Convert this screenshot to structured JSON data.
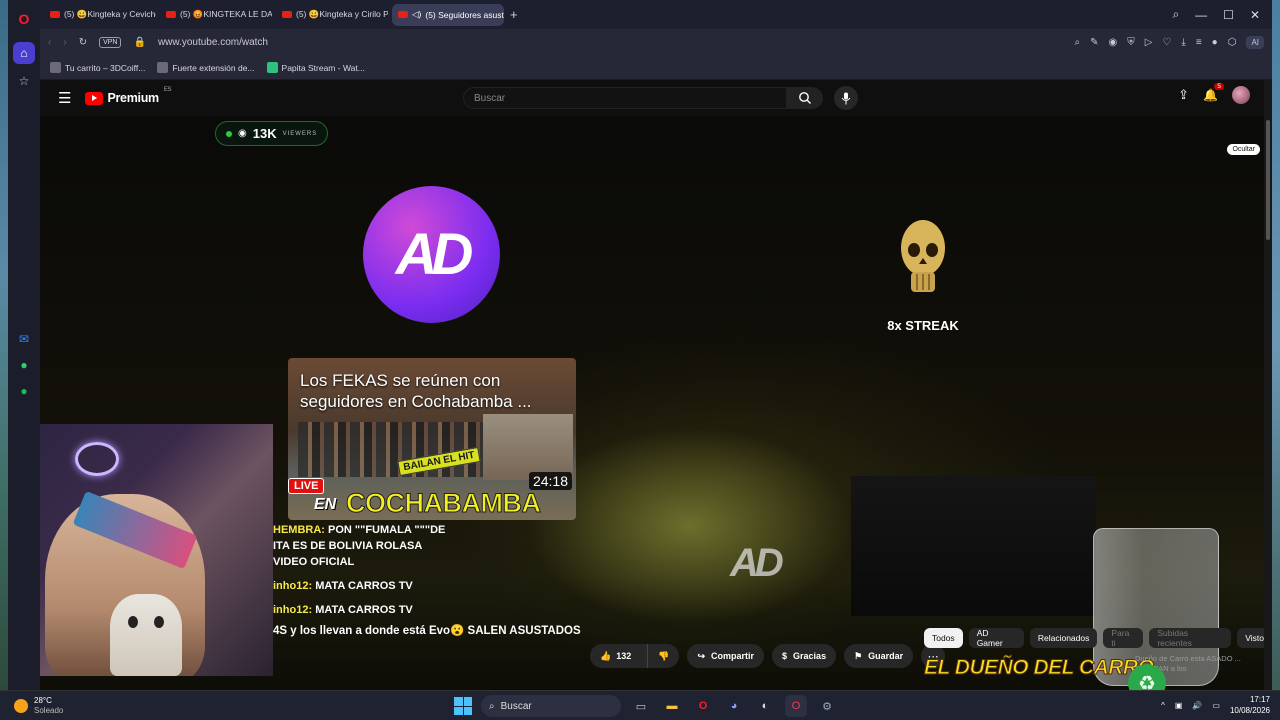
{
  "browser": {
    "tabs": [
      {
        "label": "(5) 😀Kingteka y Ceviche",
        "active": false
      },
      {
        "label": "(5) 😡KINGTEKA LE DA LA CO",
        "active": false
      },
      {
        "label": "(5) 😀Kingteka y Cirilo Pre",
        "active": false
      },
      {
        "label": "(5) Seguidores asusta",
        "active": true
      }
    ],
    "new_tab": "+",
    "vpn_label": "VPN",
    "url": "www.youtube.com/watch",
    "ai_label": "AI",
    "bookmarks": [
      {
        "label": "Tu carrito – 3DCoiff..."
      },
      {
        "label": "Fuerte extensión de..."
      },
      {
        "label": "Papita Stream - Wat..."
      }
    ]
  },
  "youtube": {
    "logo_text": "Premium",
    "region": "ES",
    "search_placeholder": "Buscar",
    "notification_count": "5"
  },
  "video": {
    "viewers_count": "13K",
    "viewers_label": "VIEWERS",
    "hide_label": "Ocultar",
    "logo_text": "AD",
    "streak_text": "8x STREAK",
    "watermark": "AD",
    "thumbnail": {
      "title": "Los FEKAS se reúnen con seguidores en Cochabamba ...",
      "badge_bailan": "BAILAN EL HIT",
      "live": "LIVE",
      "en": "EN",
      "city": "COCHABAMBA",
      "duration": "24:18"
    },
    "chat": [
      {
        "user": "HEMBRA:",
        "text": "PON \"\"FUMALA \"\"\"DE"
      },
      {
        "user": "",
        "text": "ITA ES DE BOLIVIA ROLASA"
      },
      {
        "user": "",
        "text": "VIDEO OFICIAL"
      },
      {
        "user": "inho12:",
        "text": "MATA CARROS TV"
      },
      {
        "user": "inho12:",
        "text": "MATA CARROS TV"
      }
    ],
    "ticker": "4S y los llevan a donde está Evo😮 SALEN ASUSTADOS"
  },
  "actions": {
    "likes": "132",
    "share": "Compartir",
    "thanks": "Gracias",
    "save": "Guardar"
  },
  "chips": [
    {
      "label": "Todos",
      "selected": true
    },
    {
      "label": "AD Gamer",
      "selected": false
    },
    {
      "label": "Relacionados",
      "selected": false
    },
    {
      "label": "Para ti",
      "selected": false,
      "dim": true
    },
    {
      "label": "Subidas recientes",
      "selected": false,
      "dim": true
    },
    {
      "label": "Visto",
      "selected": false
    }
  ],
  "recommended": {
    "banner": "EL DUEÑO DEL CARRO",
    "title": "Dueño de Carro esta ASADO ... ESTAFAN a los"
  },
  "taskbar": {
    "temperature": "28°C",
    "weather": "Soleado",
    "search": "Buscar",
    "time": "17:17",
    "date": "10/08/2026"
  }
}
